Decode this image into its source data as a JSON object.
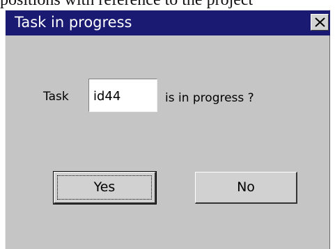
{
  "background": {
    "text": "positions with reference to the project"
  },
  "dialog": {
    "title": "Task in progress",
    "close_icon": "close-x-icon",
    "task_label": "Task",
    "task_value": "id44",
    "question_text": "is in progress ?",
    "yes_label": "Yes",
    "no_label": "No"
  },
  "colors": {
    "titlebar": "#1a1a73",
    "dialog_bg": "#c6c5c6",
    "title_text": "#ffffff"
  }
}
